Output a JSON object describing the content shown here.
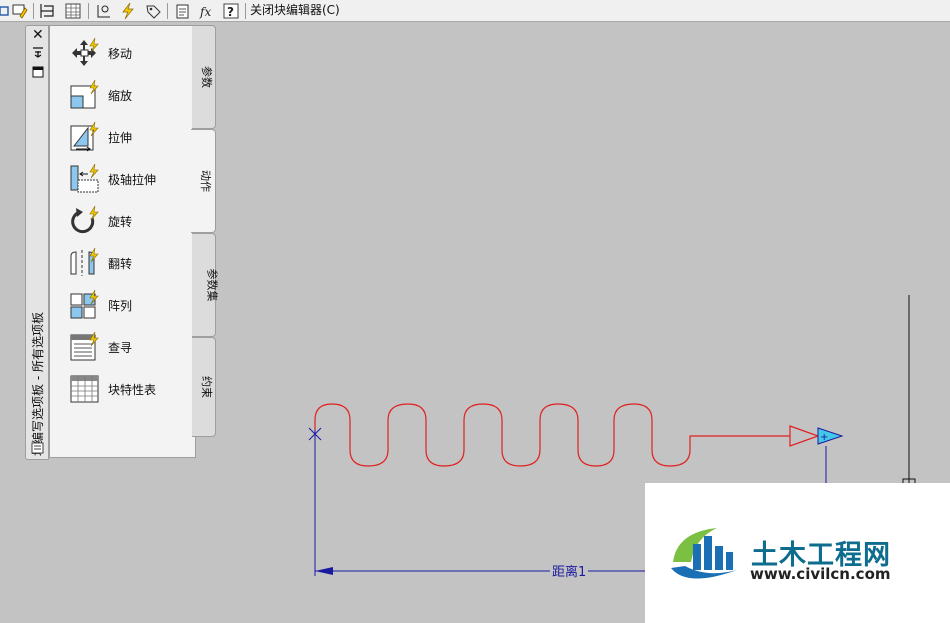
{
  "toolbar": {
    "close_block_editor": "关闭块编辑器(C)"
  },
  "palette": {
    "title": "块编写选项板 - 所有选项板",
    "items": [
      {
        "label": "移动",
        "icon": "move-action-icon"
      },
      {
        "label": "缩放",
        "icon": "scale-action-icon"
      },
      {
        "label": "拉伸",
        "icon": "stretch-action-icon"
      },
      {
        "label": "极轴拉伸",
        "icon": "polar-stretch-action-icon"
      },
      {
        "label": "旋转",
        "icon": "rotate-action-icon"
      },
      {
        "label": "翻转",
        "icon": "flip-action-icon"
      },
      {
        "label": "阵列",
        "icon": "array-action-icon"
      },
      {
        "label": "查寻",
        "icon": "lookup-action-icon"
      },
      {
        "label": "块特性表",
        "icon": "block-properties-table-icon"
      }
    ],
    "tabs": [
      {
        "label": "参数",
        "active": false
      },
      {
        "label": "动作",
        "active": true
      },
      {
        "label": "参数集",
        "active": false
      },
      {
        "label": "约束",
        "active": false
      }
    ]
  },
  "drawing": {
    "dimension_label": "距离1",
    "spring_color": "#e02020",
    "dim_color": "#1a1aa0"
  },
  "watermark": {
    "name": "土木工程网",
    "url": "www.civilcn.com"
  }
}
